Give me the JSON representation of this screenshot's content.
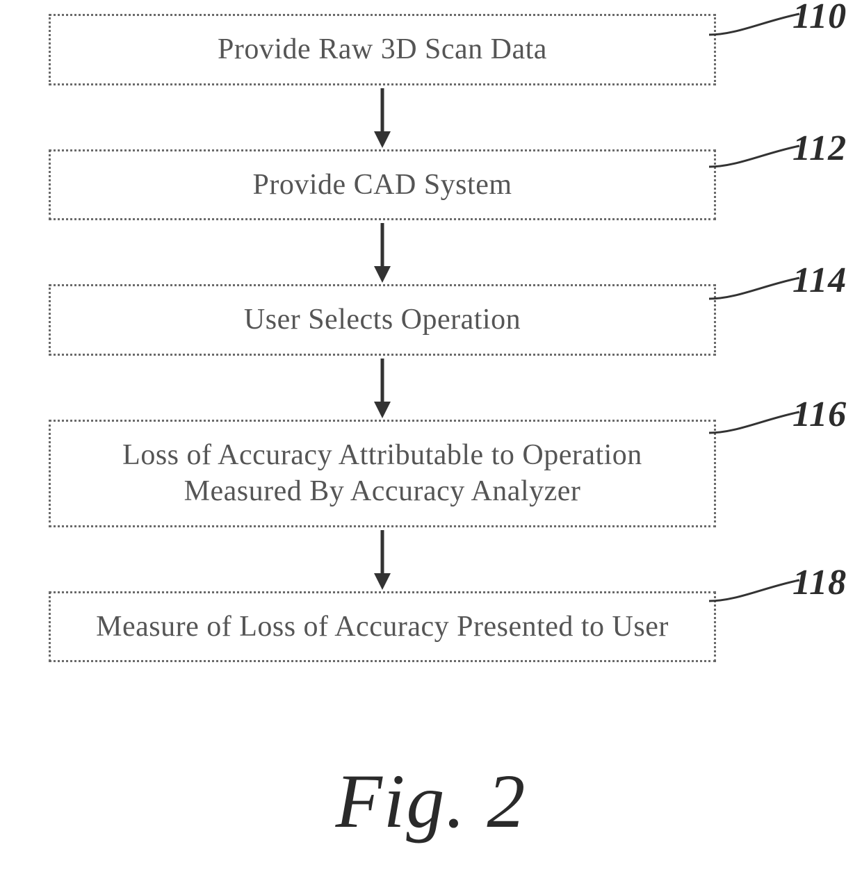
{
  "flowchart": {
    "steps": [
      {
        "id": "110",
        "text": "Provide Raw 3D Scan Data"
      },
      {
        "id": "112",
        "text": "Provide CAD System"
      },
      {
        "id": "114",
        "text": "User Selects Operation"
      },
      {
        "id": "116",
        "text": "Loss of Accuracy Attributable to Operation Measured By Accuracy Analyzer"
      },
      {
        "id": "118",
        "text": "Measure of Loss of Accuracy Presented to User"
      }
    ]
  },
  "caption": "Fig. 2"
}
